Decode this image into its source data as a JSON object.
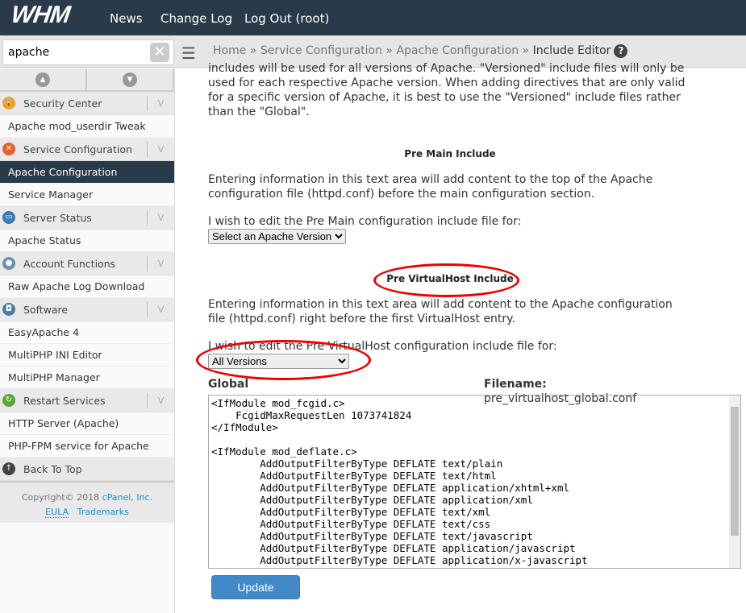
{
  "header": {
    "logo": "WHM",
    "nav": [
      "News",
      "Change Log",
      "Log Out (root)"
    ]
  },
  "search": {
    "value": "apache"
  },
  "breadcrumb": {
    "items": [
      "Home",
      "Service Configuration",
      "Apache Configuration"
    ],
    "current": "Include Editor",
    "sep": "»"
  },
  "sidebar": {
    "groups": [
      {
        "label": "Security Center",
        "icon": "lock-icon",
        "color": "#f0a030",
        "items": [
          "Apache mod_userdir Tweak"
        ]
      },
      {
        "label": "Service Configuration",
        "icon": "wrench-icon",
        "color": "#e8602c",
        "items": [
          "Apache Configuration",
          "Service Manager"
        ]
      },
      {
        "label": "Server Status",
        "icon": "monitor-icon",
        "color": "#3a7ab5",
        "items": [
          "Apache Status"
        ]
      },
      {
        "label": "Account Functions",
        "icon": "user-icon",
        "color": "#6b8fb5",
        "items": [
          "Raw Apache Log Download"
        ]
      },
      {
        "label": "Software",
        "icon": "box-icon",
        "color": "#4a7fa8",
        "items": [
          "EasyApache 4",
          "MultiPHP INI Editor",
          "MultiPHP Manager"
        ]
      },
      {
        "label": "Restart Services",
        "icon": "restart-icon",
        "color": "#5aa832",
        "items": [
          "HTTP Server (Apache)",
          "PHP-FPM service for Apache"
        ]
      }
    ],
    "active": "Apache Configuration",
    "back_to_top": "Back To Top",
    "footer": {
      "copyright": "Copyright© 2018",
      "company": "cPanel, Inc.",
      "eula": "EULA",
      "trademarks": "Trademarks"
    }
  },
  "main": {
    "intro": "includes will be used for all versions of Apache. \"Versioned\" include files will only be used for each respective Apache version. When adding directives that are only valid for a specific version of Apache, it is best to use the \"Versioned\" include files rather than the \"Global\".",
    "pre_main": {
      "title": "Pre Main Include",
      "desc": "Entering information in this text area will add content to the top of the Apache configuration file (httpd.conf) before the main configuration section.",
      "prompt": "I wish to edit the Pre Main configuration include file for:",
      "select": "Select an Apache Version"
    },
    "pre_vhost": {
      "title": "Pre VirtualHost Include",
      "desc": "Entering information in this text area will add content to the Apache configuration file (httpd.conf) right before the first VirtualHost entry.",
      "prompt": "I wish to edit the Pre VirtualHost configuration include file for:",
      "select": "All Versions"
    },
    "editor": {
      "scope": "Global",
      "filename_label": "Filename:",
      "filename": "pre_virtualhost_global.conf",
      "content": "<IfModule mod_fcgid.c>\n    FcgidMaxRequestLen 1073741824\n</IfModule>\n\n<IfModule mod_deflate.c>\n        AddOutputFilterByType DEFLATE text/plain\n        AddOutputFilterByType DEFLATE text/html\n        AddOutputFilterByType DEFLATE application/xhtml+xml\n        AddOutputFilterByType DEFLATE application/xml\n        AddOutputFilterByType DEFLATE text/xml\n        AddOutputFilterByType DEFLATE text/css\n        AddOutputFilterByType DEFLATE text/javascript\n        AddOutputFilterByType DEFLATE application/javascript\n        AddOutputFilterByType DEFLATE application/x-javascript\n</IfModule>"
    },
    "update_label": "Update",
    "highlight_color": "#e00000"
  }
}
